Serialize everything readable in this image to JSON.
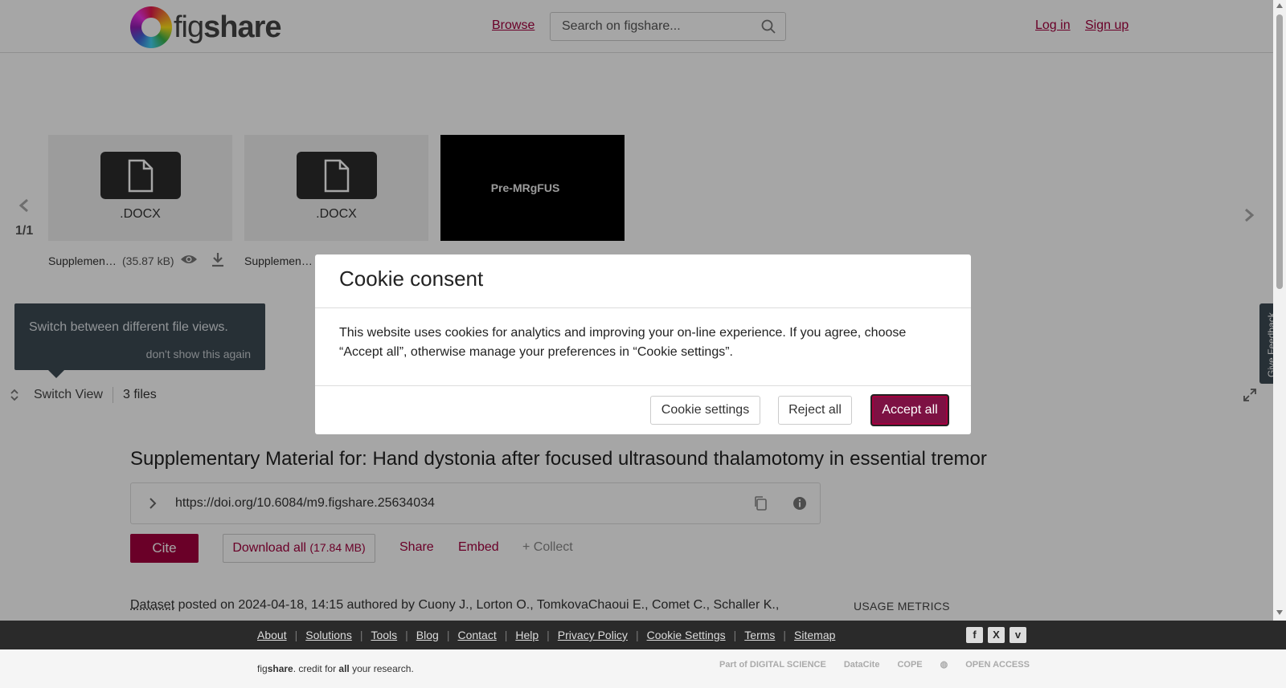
{
  "header": {
    "logo_prefix": "fig",
    "logo_suffix": "share",
    "browse": "Browse",
    "search_placeholder": "Search on figshare...",
    "login": "Log in",
    "signup": "Sign up"
  },
  "viewer": {
    "files": [
      {
        "ext": ".DOCX",
        "name": "Supplemen…",
        "size": "(35.87 kB)"
      },
      {
        "ext": ".DOCX",
        "name": "Supplemen…",
        "size": ""
      }
    ],
    "preview_label": "Pre-MRgFUS",
    "pager": "1/1",
    "tooltip_message": "Switch between different file views.",
    "tooltip_dismiss": "don't show this again",
    "switch_view": "Switch View",
    "files_count": "3 files",
    "feedback": "Give Feedback"
  },
  "article": {
    "title": "Supplementary Material for: Hand dystonia after focused ultrasound thalamotomy in essential tremor",
    "doi": "https://doi.org/10.6084/m9.figshare.25634034",
    "cite": "Cite",
    "download_all": "Download all ",
    "download_size": "(17.84 MB)",
    "share": "Share",
    "embed": "Embed",
    "collect": "+ Collect",
    "dataset_type": "Dataset",
    "byline": " posted on 2024-04-18, 14:15 authored by Cuony J., Lorton O., TomkovaChaoui E., Comet C., Schaller K.,",
    "usage_metrics": "USAGE METRICS"
  },
  "footer": {
    "links": [
      "About",
      "Solutions",
      "Tools",
      "Blog",
      "Contact",
      "Help",
      "Privacy Policy",
      "Cookie Settings",
      "Terms",
      "Sitemap"
    ],
    "credit_prefix": "fig",
    "credit_bold": "share",
    "credit_mid": ". credit for ",
    "credit_all": "all",
    "credit_end": " your research.",
    "partners": [
      "Part of DIGITAL SCIENCE",
      "DataCite",
      "COPE",
      "",
      "OPEN ACCESS"
    ]
  },
  "cookie_modal": {
    "title": "Cookie consent",
    "body": "This website uses cookies for analytics and improving your on-line experience. If you agree, choose “Accept all”, otherwise manage your preferences in “Cookie settings”.",
    "settings": "Cookie settings",
    "reject": "Reject all",
    "accept": "Accept all"
  },
  "colors": {
    "brand": "#a3003e",
    "accept_button": "#7d1143",
    "tooltip_bg": "#3d4a54"
  }
}
